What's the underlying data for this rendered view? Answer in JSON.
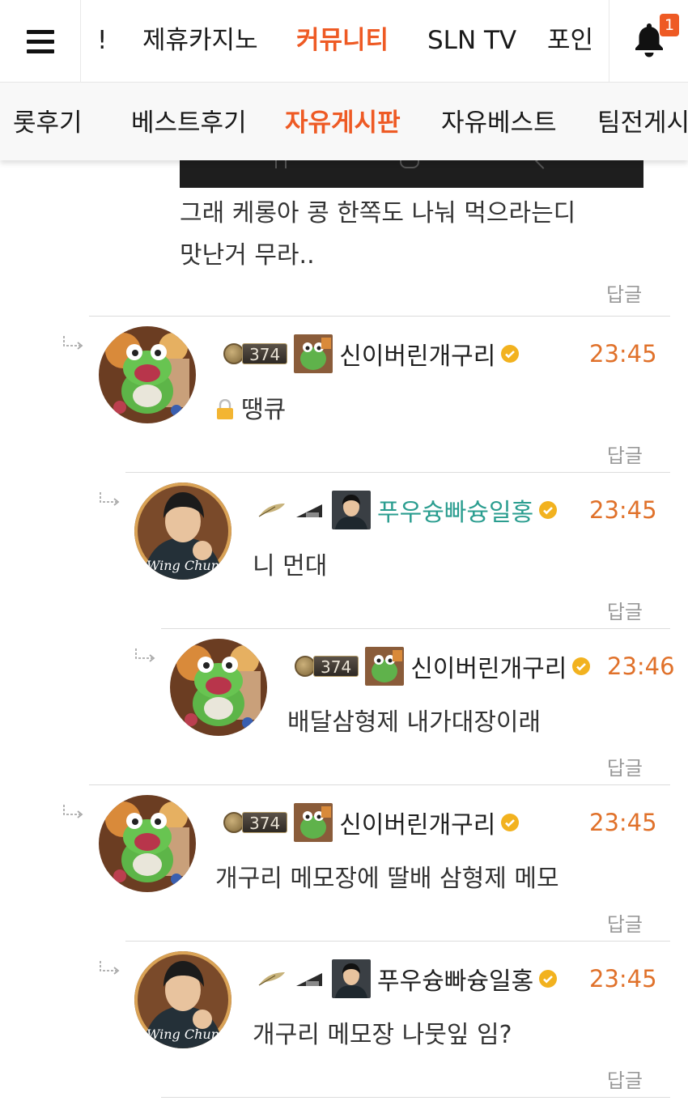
{
  "topnav": {
    "tabs": [
      {
        "label": "!"
      },
      {
        "label": "제휴카지노"
      },
      {
        "label": "커뮤니티",
        "active": true
      },
      {
        "label": "SLN TV"
      },
      {
        "label": "포인"
      }
    ],
    "notification_count": "1",
    "accent_color": "#ee5a24"
  },
  "subnav": {
    "tabs": [
      {
        "label": "롯후기"
      },
      {
        "label": "베스트후기"
      },
      {
        "label": "자유게시판",
        "active": true
      },
      {
        "label": "자유베스트"
      },
      {
        "label": "팀전게시"
      }
    ]
  },
  "post": {
    "text_line1": "그래 케롱아 콩 한쪽도 나눠 먹으라는디",
    "text_line2": "맛난거 무라..",
    "reply_label": "답글"
  },
  "comments": [
    {
      "nickname": "신이버린개구리",
      "level": "374",
      "time": "23:45",
      "body": "땡큐",
      "locked": true,
      "reply_label": "답글"
    },
    {
      "nickname": "푸우슝빠슝일홍",
      "time": "23:45",
      "body": "니 먼대",
      "reply_label": "답글"
    },
    {
      "nickname": "신이버린개구리",
      "level": "374",
      "time": "23:46",
      "body": "배달삼형제 내가대장이래",
      "reply_label": "답글"
    },
    {
      "nickname": "신이버린개구리",
      "level": "374",
      "time": "23:45",
      "body": "개구리 메모장에 딸배 삼형제 메모",
      "reply_label": "답글"
    },
    {
      "nickname": "푸우슝빠슝일홍",
      "time": "23:45",
      "body": "개구리 메모장 나뭇잎 임?",
      "reply_label": "답글"
    }
  ],
  "avatar_labels": {
    "wing_chun": "Wing Chun"
  }
}
